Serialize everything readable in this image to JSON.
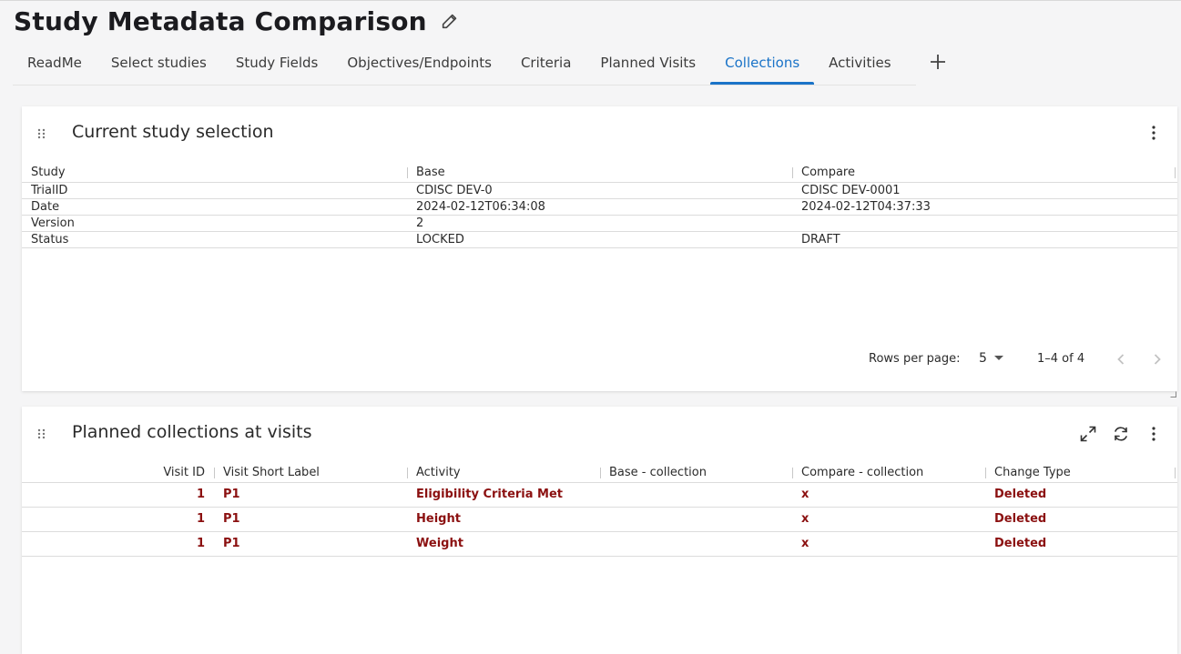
{
  "page": {
    "title": "Study Metadata Comparison"
  },
  "tabs": [
    {
      "label": "ReadMe"
    },
    {
      "label": "Select studies"
    },
    {
      "label": "Study Fields"
    },
    {
      "label": "Objectives/Endpoints"
    },
    {
      "label": "Criteria"
    },
    {
      "label": "Planned Visits"
    },
    {
      "label": "Collections",
      "active": true
    },
    {
      "label": "Activities"
    }
  ],
  "selection_card": {
    "title": "Current study selection",
    "columns": [
      "Study",
      "Base",
      "Compare"
    ],
    "rows": [
      [
        "TrialID",
        "CDISC DEV-0",
        "CDISC DEV-0001"
      ],
      [
        "Date",
        "2024-02-12T06:34:08",
        "2024-02-12T04:37:33"
      ],
      [
        "Version",
        "2",
        ""
      ],
      [
        "Status",
        "LOCKED",
        "DRAFT"
      ]
    ],
    "pagination": {
      "rows_per_page_label": "Rows per page:",
      "rows_per_page": "5",
      "range": "1–4 of 4"
    }
  },
  "collections_card": {
    "title": "Planned collections at visits",
    "columns": [
      "Visit ID",
      "Visit Short Label",
      "Activity",
      "Base - collection",
      "Compare - collection",
      "Change Type"
    ],
    "rows": [
      [
        "1",
        "P1",
        "Eligibility Criteria Met",
        "",
        "x",
        "Deleted"
      ],
      [
        "1",
        "P1",
        "Height",
        "",
        "x",
        "Deleted"
      ],
      [
        "1",
        "P1",
        "Weight",
        "",
        "x",
        "Deleted"
      ]
    ]
  },
  "colors": {
    "accent": "#1a73c8",
    "deleted_text": "#8b1010"
  }
}
